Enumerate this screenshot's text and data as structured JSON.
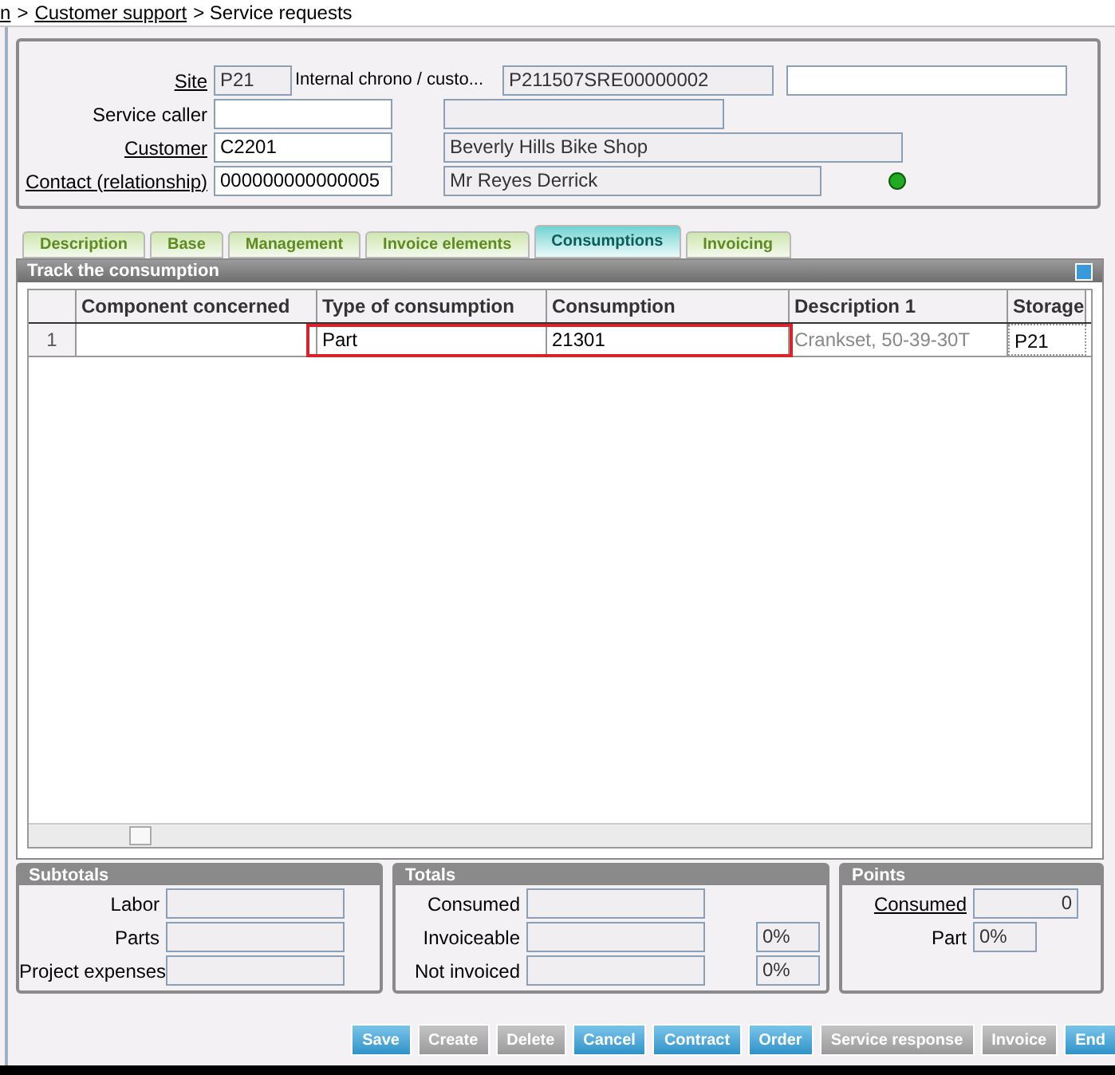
{
  "breadcrumb": [
    {
      "text": "n",
      "link": true
    },
    {
      "text": ">",
      "link": false
    },
    {
      "text": "Customer support",
      "link": true
    },
    {
      "text": "> Service requests",
      "link": false
    }
  ],
  "header": {
    "site": {
      "label": "Site",
      "value": "P21"
    },
    "chrono": {
      "label": "Internal chrono / custo...",
      "value": "P211507SRE00000002"
    },
    "service_caller": {
      "label": "Service caller"
    },
    "customer": {
      "label": "Customer",
      "value": "C2201",
      "name": "Beverly Hills Bike Shop"
    },
    "contact": {
      "label": "Contact (relationship)",
      "value": "000000000000005",
      "name": "Mr Reyes Derrick"
    },
    "status": {
      "color": "#22aa22"
    }
  },
  "tabs": [
    {
      "label": "Description",
      "selected": false
    },
    {
      "label": "Base",
      "selected": false
    },
    {
      "label": "Management",
      "selected": false
    },
    {
      "label": "Invoice elements",
      "selected": false
    },
    {
      "label": "Consumptions",
      "selected": true
    },
    {
      "label": "Invoicing",
      "selected": false
    }
  ],
  "grid": {
    "title": "Track the consumption",
    "columns": [
      "Component concerned",
      "Type of consumption",
      "Consumption",
      "Description 1",
      "Storage"
    ],
    "rows": [
      {
        "number": "1",
        "cells": [
          "",
          "Part",
          "21301",
          "Crankset, 50-39-30T",
          "P21"
        ],
        "highlighted": true
      }
    ]
  },
  "subtotals": {
    "title": "Subtotals",
    "rows": [
      {
        "label": "Labor"
      },
      {
        "label": "Parts"
      },
      {
        "label": "Project expenses"
      }
    ]
  },
  "totals": {
    "title": "Totals",
    "rows": [
      {
        "label": "Consumed"
      },
      {
        "label": "Invoiceable",
        "percent": "0%"
      },
      {
        "label": "Not invoiced",
        "percent": "0%"
      }
    ]
  },
  "points": {
    "title": "Points",
    "consumed": {
      "label": "Consumed",
      "value": "0"
    },
    "part": {
      "label": "Part",
      "value": "0%"
    }
  },
  "buttons": [
    {
      "label": "Save",
      "disabled": false
    },
    {
      "label": "Create",
      "disabled": true
    },
    {
      "label": "Delete",
      "disabled": true
    },
    {
      "label": "Cancel",
      "disabled": false
    },
    {
      "label": "Contract",
      "disabled": false
    },
    {
      "label": "Order",
      "disabled": false
    },
    {
      "label": "Service response",
      "disabled": true
    },
    {
      "label": "Invoice",
      "disabled": true
    },
    {
      "label": "End",
      "disabled": false
    }
  ]
}
